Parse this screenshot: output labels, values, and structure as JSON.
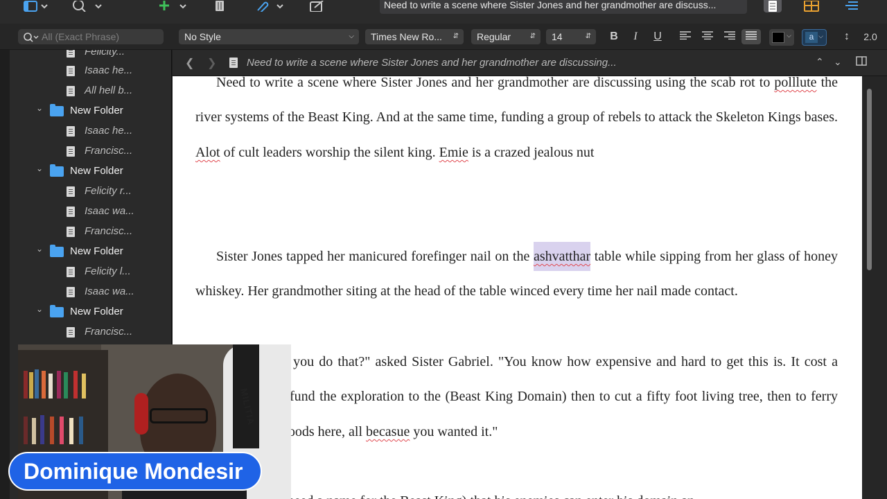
{
  "toolbar": {
    "document_title": "Need to write a scene where Sister Jones and her grandmother are discuss..."
  },
  "formatbar": {
    "search_placeholder": "All (Exact Phrase)",
    "style": "No Style",
    "font": "Times New Ro...",
    "weight": "Regular",
    "size": "14",
    "bold": "B",
    "italic": "I",
    "underline": "U",
    "line_spacing": "2.0",
    "highlight_glyph": "a"
  },
  "sidebar": {
    "items": [
      {
        "type": "doc",
        "label": "Felicity..."
      },
      {
        "type": "doc",
        "label": "Isaac he..."
      },
      {
        "type": "doc",
        "label": "All hell b..."
      },
      {
        "type": "folder",
        "label": "New Folder"
      },
      {
        "type": "doc",
        "label": "Isaac he..."
      },
      {
        "type": "doc",
        "label": "Francisc..."
      },
      {
        "type": "folder",
        "label": "New Folder"
      },
      {
        "type": "doc",
        "label": "Felicity r..."
      },
      {
        "type": "doc",
        "label": "Isaac wa..."
      },
      {
        "type": "doc",
        "label": "Francisc..."
      },
      {
        "type": "folder",
        "label": "New Folder"
      },
      {
        "type": "doc",
        "label": "Felicity l..."
      },
      {
        "type": "doc",
        "label": "Isaac wa..."
      },
      {
        "type": "folder",
        "label": "New Folder"
      },
      {
        "type": "doc",
        "label": "Francisc..."
      }
    ]
  },
  "editor": {
    "header_title": "Need to write a scene where Sister Jones and her grandmother are discussing...",
    "p1": {
      "a": "Need to write a scene where Sister Jones and her grandmother are discussing using the scab rot to ",
      "e1": "polllute",
      "b": " the river systems of the Beast King. And at the same time, funding a group of rebels to attack the Skeleton Kings bases. ",
      "e2": "Alot",
      "c": " of cult leaders worship the silent king. ",
      "e3": "Emie",
      "d": " is a crazed jealous nut"
    },
    "p2": {
      "a": "Sister Jones tapped her manicured forefinger nail on the ",
      "hl": "ashvatthar",
      "b": " table while sipping from her glass of honey whiskey. Her grandmother siting at the head of the table winced every time her nail made contact."
    },
    "p3": {
      "a": "\"Sister, must you do that?\" asked Sister Gabriel. \"You know how expensive and hard to get this is. It cost a small fortune to fund the exploration to the (Beast King Domain) then to cut a fifty foot living tree, then to ferry and deliver the goods here, all ",
      "e1": "becasue",
      "b": " you wanted it.\""
    },
    "p4": {
      "a": "\"... to show (need a name for the Beast King) that his enemies can enter his domain an..."
    }
  },
  "webcam": {
    "name": "Dominique Mondesir",
    "jacket_text": "MILITIA"
  }
}
